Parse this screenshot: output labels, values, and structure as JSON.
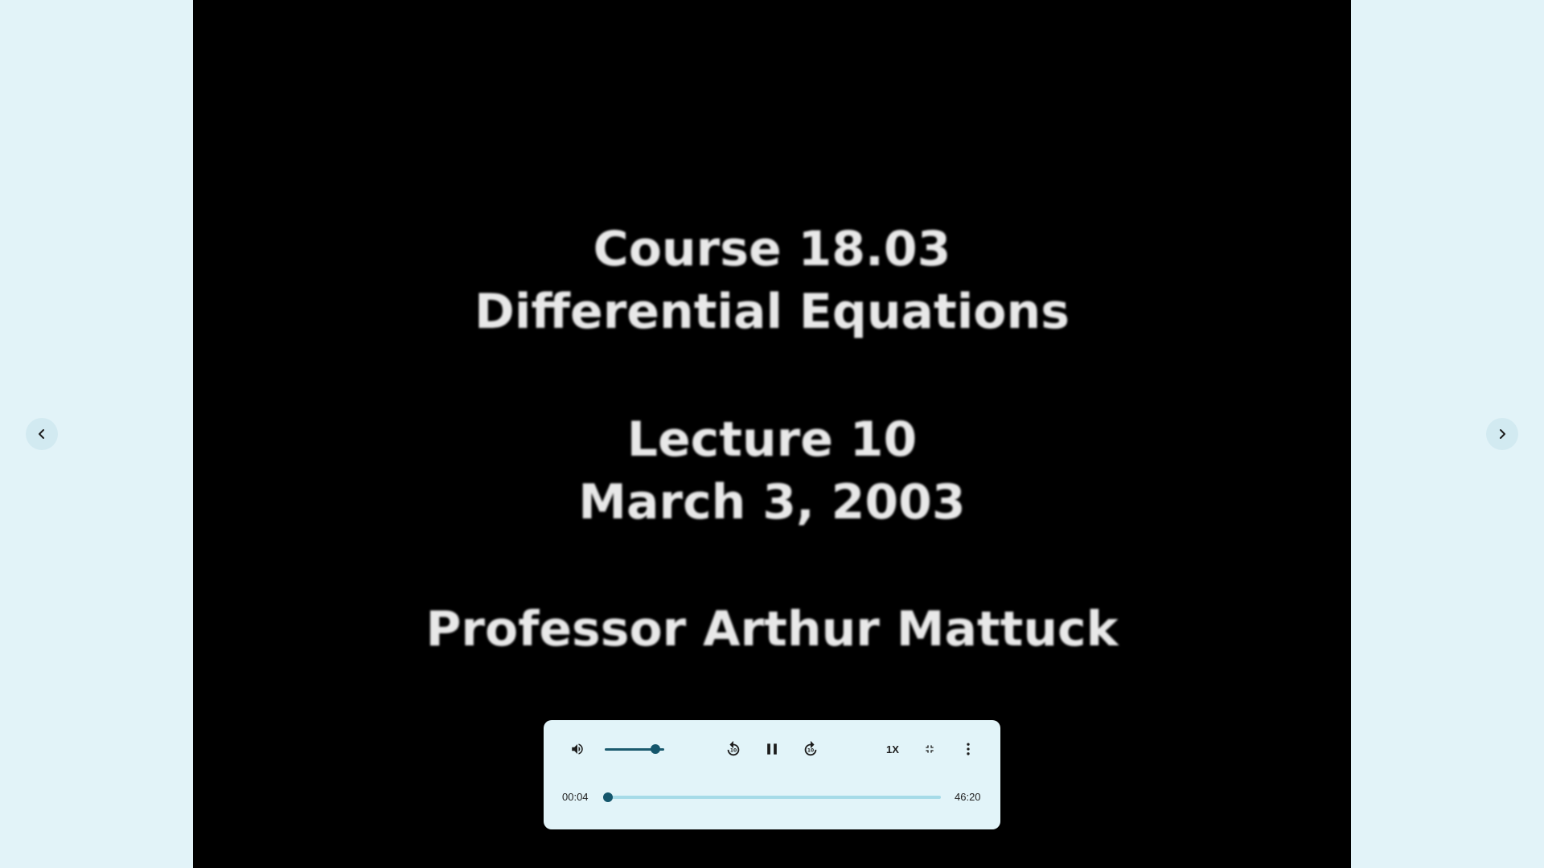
{
  "video": {
    "title_card": {
      "line1": "Course 18.03",
      "line2": "Differential Equations",
      "line3": "Lecture 10",
      "line4": "March 3, 2003",
      "line5": "Professor Arthur Mattuck"
    }
  },
  "navigation": {
    "prev_icon": "chevron-left-icon",
    "next_icon": "chevron-right-icon"
  },
  "player": {
    "volume_icon": "volume-up-icon",
    "volume_level": 0.85,
    "rewind_icon": "replay-10-icon",
    "pause_icon": "pause-icon",
    "forward_icon": "forward-10-icon",
    "speed_label": "1X",
    "fullscreen_icon": "fullscreen-exit-icon",
    "more_icon": "more-vertical-icon",
    "current_time": "00:04",
    "total_time": "46:20",
    "progress_fraction": 0.0014
  },
  "colors": {
    "page_background": "#e2f3f8",
    "video_background": "#000000",
    "controls_background": "#e2f4f9",
    "accent": "#14566c",
    "progress_track": "#a6dbe8"
  }
}
